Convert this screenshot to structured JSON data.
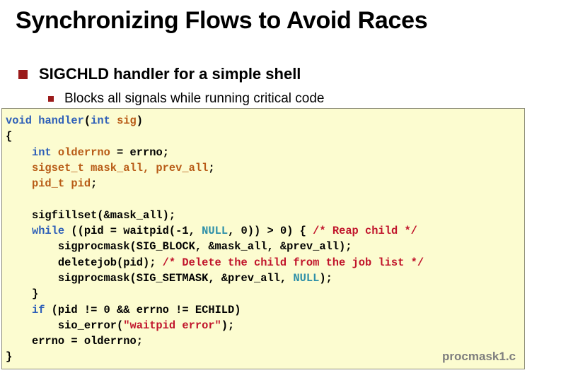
{
  "slide": {
    "title": "Synchronizing Flows to Avoid Races",
    "bullet_main": "SIGCHLD handler for a simple shell",
    "bullet_sub": "Blocks all signals while running critical code"
  },
  "code": {
    "l1_kw": "void",
    "l1_fn": "handler",
    "l1_p1": "(",
    "l1_kw2": "int",
    "l1_sp": " ",
    "l1_var": "sig",
    "l1_p2": ")",
    "l2": "{",
    "l3_kw": "int",
    "l3_var": "olderrno",
    "l3_rest": " = errno;",
    "l4_var": "sigset_t mask_all, prev_all",
    "l4_rest": ";",
    "l5_var": "pid_t pid",
    "l5_rest": ";",
    "l7": "sigfillset(&mask_all);",
    "l8_kw": "while",
    "l8_a": " ((pid = waitpid(-1, ",
    "l8_null": "NULL",
    "l8_b": ", 0)) > 0) { ",
    "l8_cm": "/* Reap child */",
    "l9": "sigprocmask(SIG_BLOCK, &mask_all, &prev_all);",
    "l10_a": "deletejob(pid); ",
    "l10_cm": "/* Delete the child from the job list */",
    "l11_a": "sigprocmask(SIG_SETMASK, &prev_all, ",
    "l11_null": "NULL",
    "l11_b": ");",
    "l12": "}",
    "l13_kw": "if",
    "l13_rest": " (pid != 0 && errno != ECHILD)",
    "l14_a": "sio_error(",
    "l14_str": "\"waitpid error\"",
    "l14_b": ");",
    "l15": "errno = olderrno;",
    "l16": "}",
    "filename": "procmask1.c"
  }
}
